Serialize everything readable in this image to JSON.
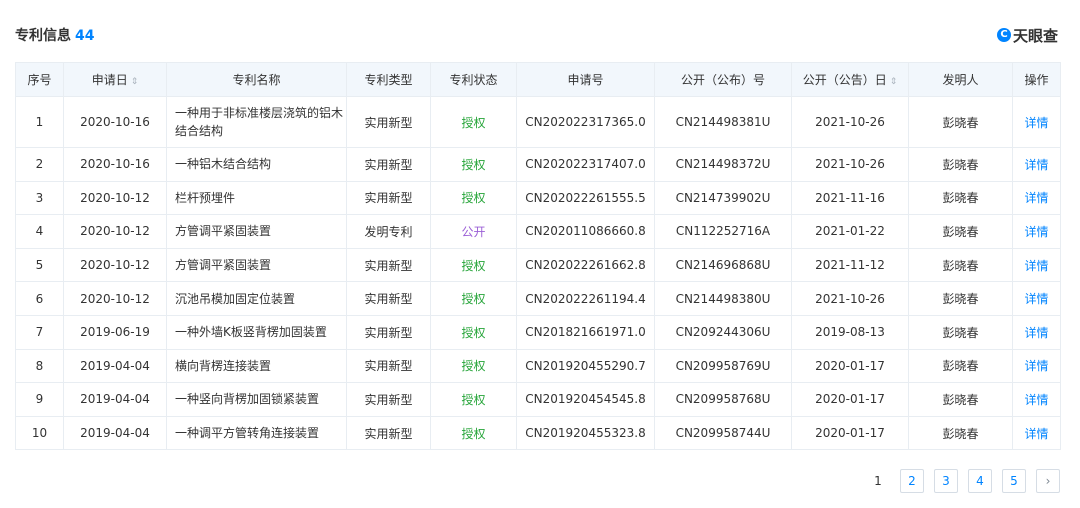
{
  "header": {
    "title": "专利信息",
    "count": "44",
    "brand": "天眼查",
    "brand_logo": "C"
  },
  "table": {
    "columns": [
      "序号",
      "申请日",
      "专利名称",
      "专利类型",
      "专利状态",
      "申请号",
      "公开（公布）号",
      "公开（公告）日",
      "发明人",
      "操作"
    ],
    "sort_icon": "⇕",
    "rows": [
      {
        "no": "1",
        "date": "2020-10-16",
        "name": "一种用于非标准楼层浇筑的铝木结合结构",
        "type": "实用新型",
        "status": "授权",
        "app_no": "CN202022317365.0",
        "pub_no": "CN214498381U",
        "pub_date": "2021-10-26",
        "inventor": "彭晓春",
        "action": "详情"
      },
      {
        "no": "2",
        "date": "2020-10-16",
        "name": "一种铝木结合结构",
        "type": "实用新型",
        "status": "授权",
        "app_no": "CN202022317407.0",
        "pub_no": "CN214498372U",
        "pub_date": "2021-10-26",
        "inventor": "彭晓春",
        "action": "详情"
      },
      {
        "no": "3",
        "date": "2020-10-12",
        "name": "栏杆预埋件",
        "type": "实用新型",
        "status": "授权",
        "app_no": "CN202022261555.5",
        "pub_no": "CN214739902U",
        "pub_date": "2021-11-16",
        "inventor": "彭晓春",
        "action": "详情"
      },
      {
        "no": "4",
        "date": "2020-10-12",
        "name": "方管调平紧固装置",
        "type": "发明专利",
        "status": "公开",
        "app_no": "CN202011086660.8",
        "pub_no": "CN112252716A",
        "pub_date": "2021-01-22",
        "inventor": "彭晓春",
        "action": "详情"
      },
      {
        "no": "5",
        "date": "2020-10-12",
        "name": "方管调平紧固装置",
        "type": "实用新型",
        "status": "授权",
        "app_no": "CN202022261662.8",
        "pub_no": "CN214696868U",
        "pub_date": "2021-11-12",
        "inventor": "彭晓春",
        "action": "详情"
      },
      {
        "no": "6",
        "date": "2020-10-12",
        "name": "沉池吊模加固定位装置",
        "type": "实用新型",
        "status": "授权",
        "app_no": "CN202022261194.4",
        "pub_no": "CN214498380U",
        "pub_date": "2021-10-26",
        "inventor": "彭晓春",
        "action": "详情"
      },
      {
        "no": "7",
        "date": "2019-06-19",
        "name": "一种外墙K板竖背楞加固装置",
        "type": "实用新型",
        "status": "授权",
        "app_no": "CN201821661971.0",
        "pub_no": "CN209244306U",
        "pub_date": "2019-08-13",
        "inventor": "彭晓春",
        "action": "详情"
      },
      {
        "no": "8",
        "date": "2019-04-04",
        "name": "横向背楞连接装置",
        "type": "实用新型",
        "status": "授权",
        "app_no": "CN201920455290.7",
        "pub_no": "CN209958769U",
        "pub_date": "2020-01-17",
        "inventor": "彭晓春",
        "action": "详情"
      },
      {
        "no": "9",
        "date": "2019-04-04",
        "name": "一种竖向背楞加固锁紧装置",
        "type": "实用新型",
        "status": "授权",
        "app_no": "CN201920454545.8",
        "pub_no": "CN209958768U",
        "pub_date": "2020-01-17",
        "inventor": "彭晓春",
        "action": "详情"
      },
      {
        "no": "10",
        "date": "2019-04-04",
        "name": "一种调平方管转角连接装置",
        "type": "实用新型",
        "status": "授权",
        "app_no": "CN201920455323.8",
        "pub_no": "CN209958744U",
        "pub_date": "2020-01-17",
        "inventor": "彭晓春",
        "action": "详情"
      }
    ]
  },
  "pagination": {
    "pages": [
      "1",
      "2",
      "3",
      "4",
      "5"
    ],
    "current": "1",
    "next": "›"
  },
  "colors": {
    "accent": "#0084ff",
    "granted": "#27a53a",
    "published": "#9b5fd6"
  }
}
